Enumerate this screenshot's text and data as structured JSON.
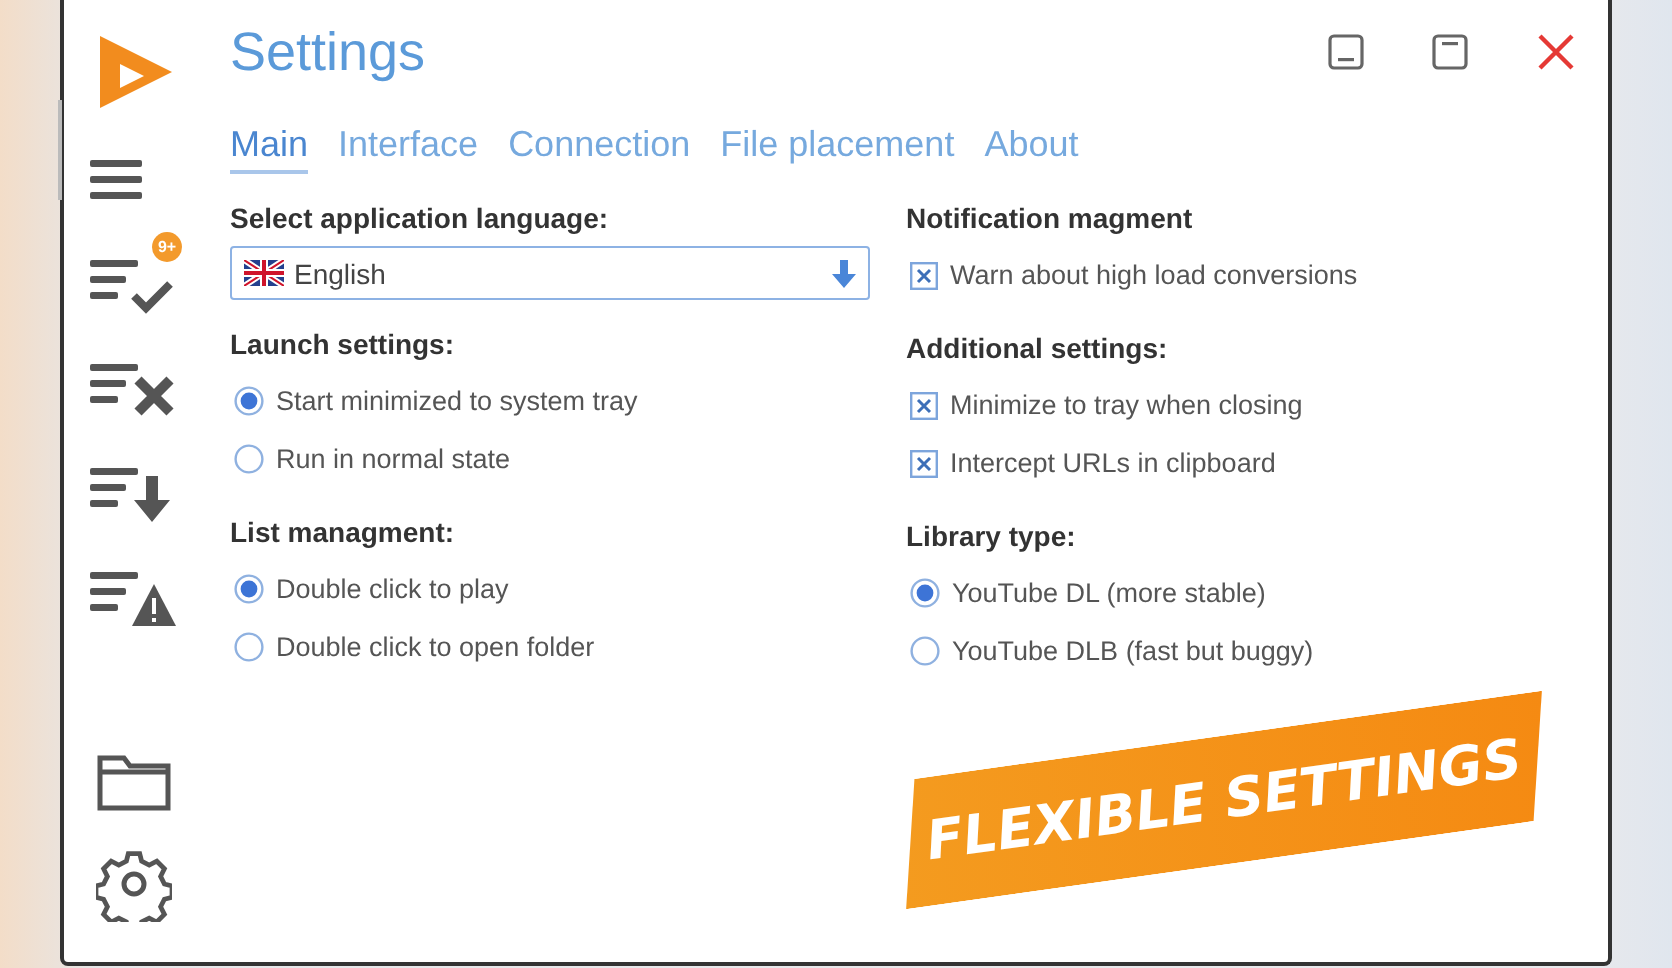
{
  "window": {
    "title": "Settings"
  },
  "sidebar": {
    "items": [
      {
        "kind": "list",
        "selected": true
      },
      {
        "kind": "list-check",
        "selected": false,
        "badge": "9+"
      },
      {
        "kind": "list-x",
        "selected": false
      },
      {
        "kind": "list-down",
        "selected": false
      },
      {
        "kind": "list-warning",
        "selected": false
      },
      {
        "kind": "folder",
        "selected": false
      },
      {
        "kind": "gear",
        "selected": false
      }
    ]
  },
  "tabs": [
    {
      "label": "Main",
      "selected": true
    },
    {
      "label": "Interface",
      "selected": false
    },
    {
      "label": "Connection",
      "selected": false
    },
    {
      "label": "File placement",
      "selected": false
    },
    {
      "label": "About",
      "selected": false
    }
  ],
  "columns": [
    {
      "groups": [
        {
          "heading": "Select application language:",
          "kind": "dropdown",
          "value": "English"
        },
        {
          "heading": "Launch settings:",
          "kind": "radio",
          "options": [
            {
              "label": "Start minimized to system tray",
              "selected": true
            },
            {
              "label": "Run in normal state",
              "selected": false
            }
          ]
        },
        {
          "heading": "List managment:",
          "kind": "radio",
          "options": [
            {
              "label": "Double click to play",
              "selected": true
            },
            {
              "label": "Double click to open folder",
              "selected": false
            }
          ]
        }
      ]
    },
    {
      "groups": [
        {
          "heading": "Notification magment",
          "kind": "checkbox",
          "options": [
            {
              "label": "Warn about high load conversions",
              "checked": true
            }
          ]
        },
        {
          "heading": "Additional settings:",
          "kind": "checkbox",
          "options": [
            {
              "label": "Minimize to tray when closing",
              "checked": true
            },
            {
              "label": "Intercept URLs in clipboard",
              "checked": true
            }
          ]
        },
        {
          "heading": "Library type:",
          "kind": "radio",
          "options": [
            {
              "label": "YouTube DL (more stable)",
              "selected": true
            },
            {
              "label": "YouTube DLB (fast but buggy)",
              "selected": false
            }
          ]
        }
      ]
    }
  ],
  "banner": {
    "text": "FLEXIBLE SETTINGS"
  }
}
